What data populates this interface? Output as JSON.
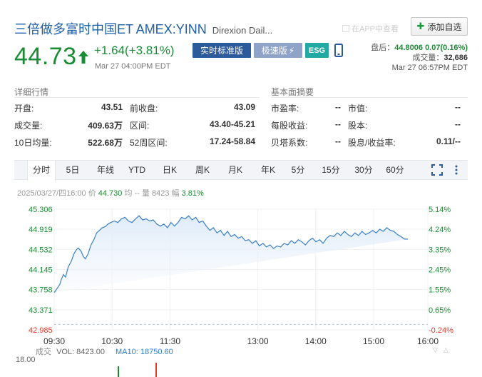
{
  "header": {
    "name": "三倍做多富时中国ET AMEX:YINN",
    "desc": "Direxion Dail...",
    "app_link": "在APP中查看",
    "add_watch": "添加自选"
  },
  "quote": {
    "price": "44.73",
    "change": "+1.64(+3.81%)",
    "time": "Mar 27 04:00PM EDT",
    "badge_realtime": "实时标准版",
    "badge_fast": "极速版",
    "badge_esg": "ESG"
  },
  "after_hours": {
    "label": "盘后：",
    "value": "44.8006 0.07(0.16%)",
    "volume_label": "成交量：",
    "volume": "32,686",
    "time": "Mar 27 06:57PM EDT"
  },
  "details": {
    "title": "详细行情",
    "rows": [
      [
        {
          "k": "开盘:",
          "v": "43.51"
        },
        {
          "k": "前收盘:",
          "v": "43.09"
        }
      ],
      [
        {
          "k": "成交量:",
          "v": "409.63万"
        },
        {
          "k": "区间:",
          "v": "43.40-45.21"
        }
      ],
      [
        {
          "k": "10日均量:",
          "v": "522.68万"
        },
        {
          "k": "52周区间:",
          "v": "17.24-58.84"
        }
      ]
    ]
  },
  "fundamentals": {
    "title": "基本面摘要",
    "rows": [
      [
        {
          "k": "市盈率:",
          "v": "--"
        },
        {
          "k": "市值:",
          "v": "--"
        }
      ],
      [
        {
          "k": "每股收益:",
          "v": "--"
        },
        {
          "k": "股本:",
          "v": "--"
        }
      ],
      [
        {
          "k": "贝塔系数:",
          "v": "--"
        },
        {
          "k": "股息/收益率:",
          "v": "0.11/--"
        }
      ]
    ]
  },
  "tabs": [
    "分时",
    "5日",
    "年线",
    "YTD",
    "日K",
    "周K",
    "月K",
    "年K",
    "5分",
    "15分",
    "30分",
    "60分"
  ],
  "active_tab": 0,
  "quote_line": {
    "date": "2025/03/27/四16:00",
    "price_label": "价",
    "price": "44.730",
    "avg_label": "均",
    "avg": "--",
    "vol_label": "量",
    "vol": "8423",
    "pct_label": "幅",
    "pct": "3.81%"
  },
  "chart_data": {
    "type": "line",
    "title": "",
    "xlabel": "",
    "ylabel": "",
    "ylim": [
      42.985,
      45.306
    ],
    "yticks": [
      "45.306",
      "44.919",
      "44.532",
      "44.145",
      "43.758",
      "43.371",
      "42.985"
    ],
    "pct_ticks": [
      "5.14%",
      "4.24%",
      "3.35%",
      "2.45%",
      "1.55%",
      "0.65%",
      "-0.24%"
    ],
    "xticks": [
      "09:30",
      "10:30",
      "11:30",
      "13:00",
      "14:00",
      "15:00",
      "16:00"
    ],
    "prev_close": 43.09,
    "x": [
      0,
      2,
      5,
      8,
      10,
      13,
      16,
      20,
      24,
      28,
      31,
      34,
      38,
      41,
      44,
      48,
      52,
      56,
      60,
      64,
      68,
      72,
      76,
      80,
      85,
      90,
      95,
      100,
      105,
      110,
      115,
      120,
      125,
      130,
      135,
      140,
      145,
      150,
      155,
      160,
      165,
      170,
      175,
      180,
      185,
      190,
      195,
      200,
      205,
      210,
      215,
      220,
      225,
      230,
      235,
      240,
      245,
      250,
      255,
      260,
      265,
      270,
      275,
      280,
      285,
      290,
      295,
      300,
      305,
      310,
      315,
      320,
      325,
      330,
      335,
      340,
      345,
      350,
      355,
      360,
      365,
      370,
      375,
      380,
      385,
      390,
      395,
      400,
      405,
      410,
      415,
      420,
      425,
      430,
      435,
      440,
      445,
      450,
      455,
      460,
      465,
      470,
      475,
      480,
      485,
      490,
      495,
      500,
      505,
      510,
      515,
      520,
      525,
      528
    ],
    "y": [
      43.7,
      43.74,
      43.8,
      43.86,
      43.95,
      44.05,
      44.0,
      44.2,
      44.3,
      44.45,
      44.52,
      44.56,
      44.5,
      44.4,
      44.35,
      44.45,
      44.62,
      44.72,
      44.85,
      44.9,
      44.95,
      44.97,
      45.02,
      45.05,
      45.08,
      45.05,
      45.12,
      45.15,
      45.08,
      45.05,
      45.12,
      45.18,
      45.1,
      45.12,
      45.08,
      45.1,
      45.02,
      44.98,
      45.02,
      44.95,
      45.05,
      44.98,
      45.05,
      45.15,
      45.12,
      45.18,
      45.1,
      45.15,
      45.05,
      45.08,
      44.98,
      44.9,
      44.95,
      44.85,
      44.9,
      44.8,
      44.88,
      44.78,
      44.82,
      44.75,
      44.78,
      44.7,
      44.72,
      44.65,
      44.7,
      44.6,
      44.65,
      44.58,
      44.62,
      44.55,
      44.6,
      44.58,
      44.65,
      44.62,
      44.7,
      44.65,
      44.72,
      44.68,
      44.62,
      44.7,
      44.75,
      44.68,
      44.72,
      44.65,
      44.75,
      44.8,
      44.78,
      44.85,
      44.8,
      44.88,
      44.82,
      44.78,
      44.85,
      44.8,
      44.88,
      44.82,
      44.85,
      44.9,
      44.85,
      44.92,
      44.88,
      44.95,
      44.9,
      44.88,
      44.82,
      44.78,
      44.73,
      44.73
    ]
  },
  "volume": {
    "label": "成交",
    "vol": "VOL: 8423.00",
    "ma": "MA10: 18750.60",
    "max": "18.00"
  },
  "colors": {
    "up": "#1a8c34",
    "down": "#e03c31",
    "line": "#3a7fc8",
    "accent": "#2d5a9a"
  }
}
